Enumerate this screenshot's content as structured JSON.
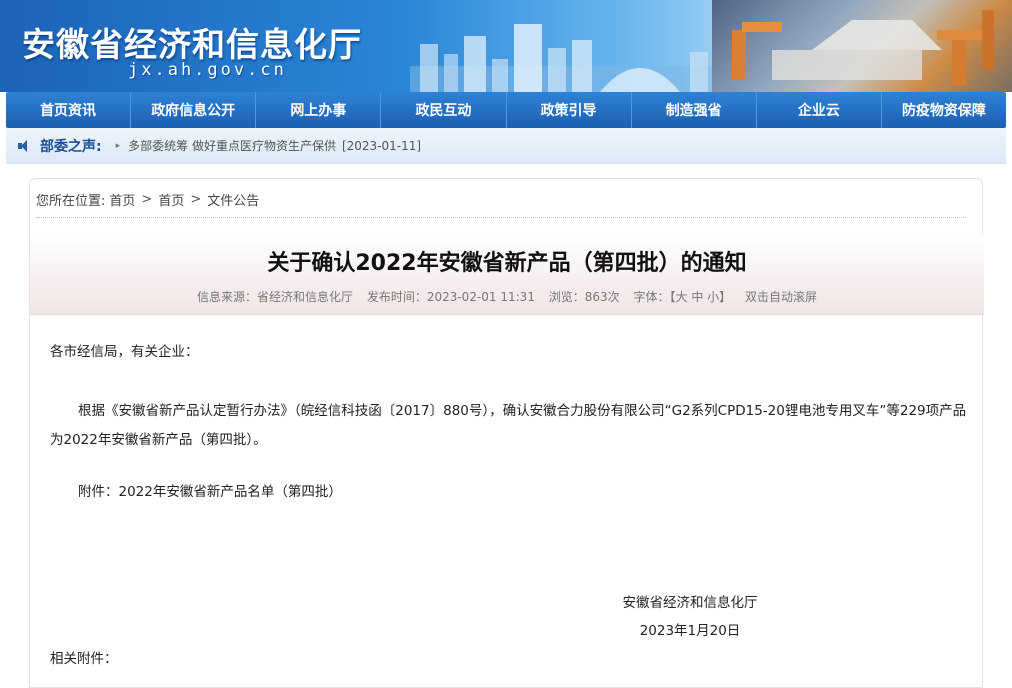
{
  "header": {
    "site_title": "安徽省经济和信息化厅",
    "site_domain": "jx.ah.gov.cn"
  },
  "nav": {
    "items": [
      {
        "label": "首页资讯"
      },
      {
        "label": "政府信息公开"
      },
      {
        "label": "网上办事"
      },
      {
        "label": "政民互动"
      },
      {
        "label": "政策引导"
      },
      {
        "label": "制造强省"
      },
      {
        "label": "企业云"
      },
      {
        "label": "防疫物资保障"
      }
    ]
  },
  "ticker": {
    "label": "部委之声:",
    "arrow": "▸",
    "text": "多部委统筹 做好重点医疗物资生产保供",
    "date": "[2023-01-11]"
  },
  "breadcrumb": {
    "prefix": "您所在位置:",
    "items": [
      "首页",
      "首页",
      "文件公告"
    ],
    "separator": ">"
  },
  "article": {
    "title": "关于确认2022年安徽省新产品（第四批）的通知",
    "meta": {
      "source": "信息来源：省经济和信息化厅",
      "published": "发布时间：2023-02-01 11:31",
      "views": "浏览：863次",
      "font_label": "字体：",
      "font_control": "【大 中 小】",
      "autoscroll": "双击自动滚屏"
    },
    "greeting": "各市经信局，有关企业：",
    "paragraph": "根据《安徽省新产品认定暂行办法》（皖经信科技函〔2017〕880号），确认安徽合力股份有限公司“G2系列CPD15-20锂电池专用叉车”等229项产品为2022年安徽省新产品（第四批）。",
    "attachment_line": "附件：2022年安徽省新产品名单（第四批）",
    "signature": "安徽省经济和信息化厅",
    "signature_date": "2023年1月20日",
    "related_label": "相关附件："
  },
  "colors": {
    "nav_bg": "#1b5fb2",
    "ticker_label": "#1d4e96",
    "title_bg": "#efe5e5"
  }
}
